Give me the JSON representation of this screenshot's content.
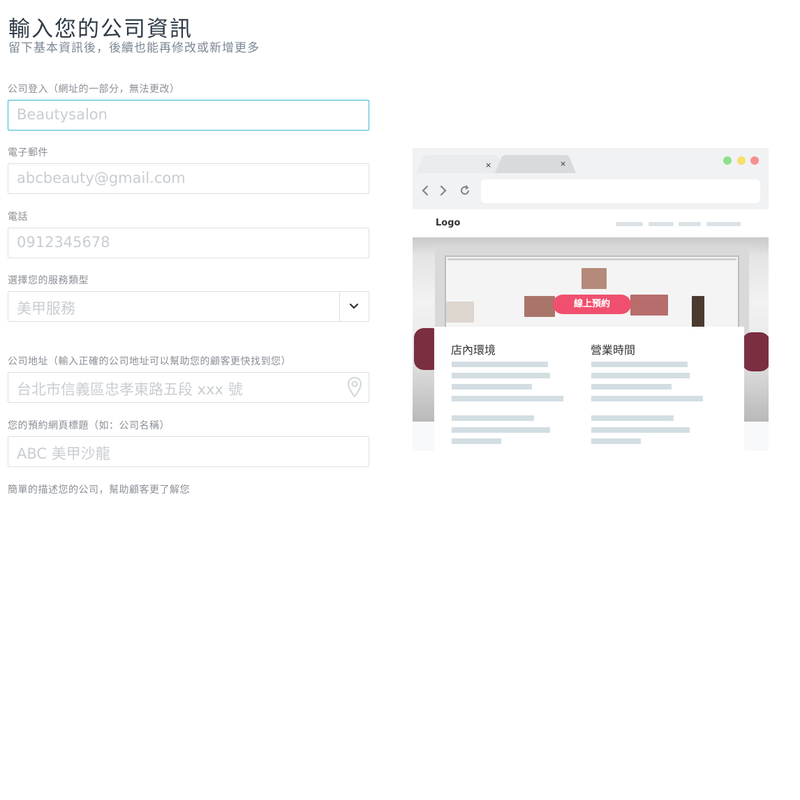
{
  "header": {
    "title": "輸入您的公司資訊",
    "subtitle": "留下基本資訊後，後續也能再修改或新增更多"
  },
  "form": {
    "company_login": {
      "label": "公司登入（網址的一部分，無法更改）",
      "placeholder": "Beautysalon"
    },
    "email": {
      "label": "電子郵件",
      "placeholder": "abcbeauty@gmail.com"
    },
    "phone": {
      "label": "電話",
      "placeholder": "0912345678"
    },
    "service_type": {
      "label": "選擇您的服務類型",
      "selected": "美甲服務",
      "icon": "chevron-down-icon"
    },
    "address": {
      "label": "公司地址（輸入正確的公司地址可以幫助您的顧客更快找到您）",
      "placeholder": "台北市信義區忠孝東路五段 xxx 號",
      "icon": "map-pin-icon"
    },
    "booking_title": {
      "label": "您的預約網頁標題（如：公司名稱）",
      "placeholder": "ABC 美甲沙龍"
    },
    "description": {
      "label": "簡單的描述您的公司，幫助顧客更了解您"
    }
  },
  "preview": {
    "tabs": [
      {
        "close": "×"
      },
      {
        "close": "×"
      }
    ],
    "window_dots": [
      "#8ee08e",
      "#f5e06a",
      "#f78f8f"
    ],
    "logo": "Logo",
    "cta": "線上預約",
    "card_sections": [
      "店內環境",
      "營業時間"
    ],
    "colors": {
      "accent": "#f0506e",
      "focus": "#38b6d4"
    }
  }
}
